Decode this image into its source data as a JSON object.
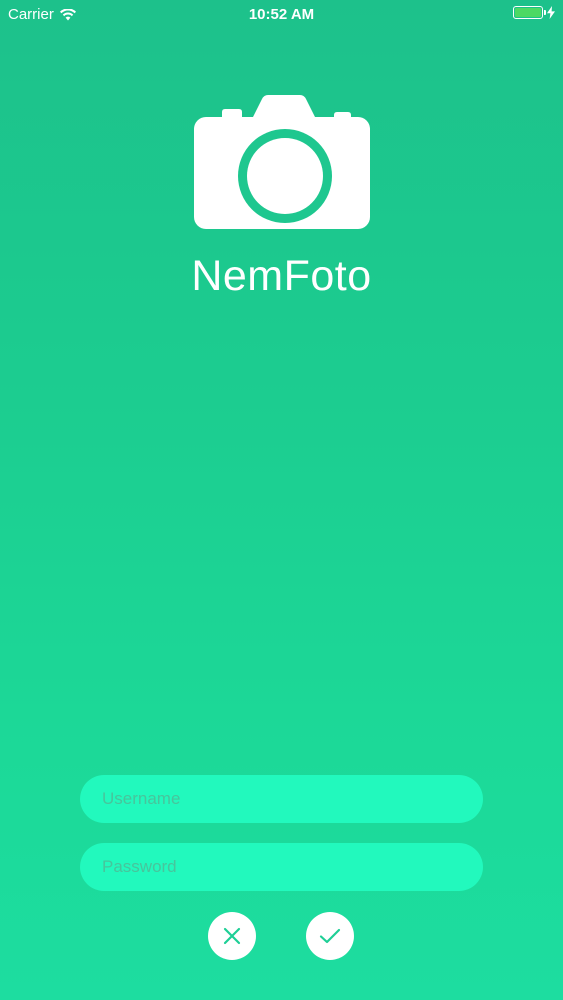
{
  "status_bar": {
    "carrier": "Carrier",
    "time": "10:52 AM",
    "icons": [
      "wifi-icon",
      "battery-icon",
      "charging-bolt-icon"
    ],
    "battery_color": "#4cd964"
  },
  "app": {
    "name": "NemFoto",
    "logo_icon": "camera-icon"
  },
  "login": {
    "username_placeholder": "Username",
    "username_value": "",
    "password_placeholder": "Password",
    "password_value": "",
    "cancel_icon": "close-icon",
    "confirm_icon": "checkmark-icon"
  },
  "colors": {
    "background_top": "#1dc18b",
    "background_bottom": "#1ddda0",
    "field_background": "#22f9bd",
    "placeholder": "#47c59c",
    "button_icon": "#1ecf96"
  }
}
